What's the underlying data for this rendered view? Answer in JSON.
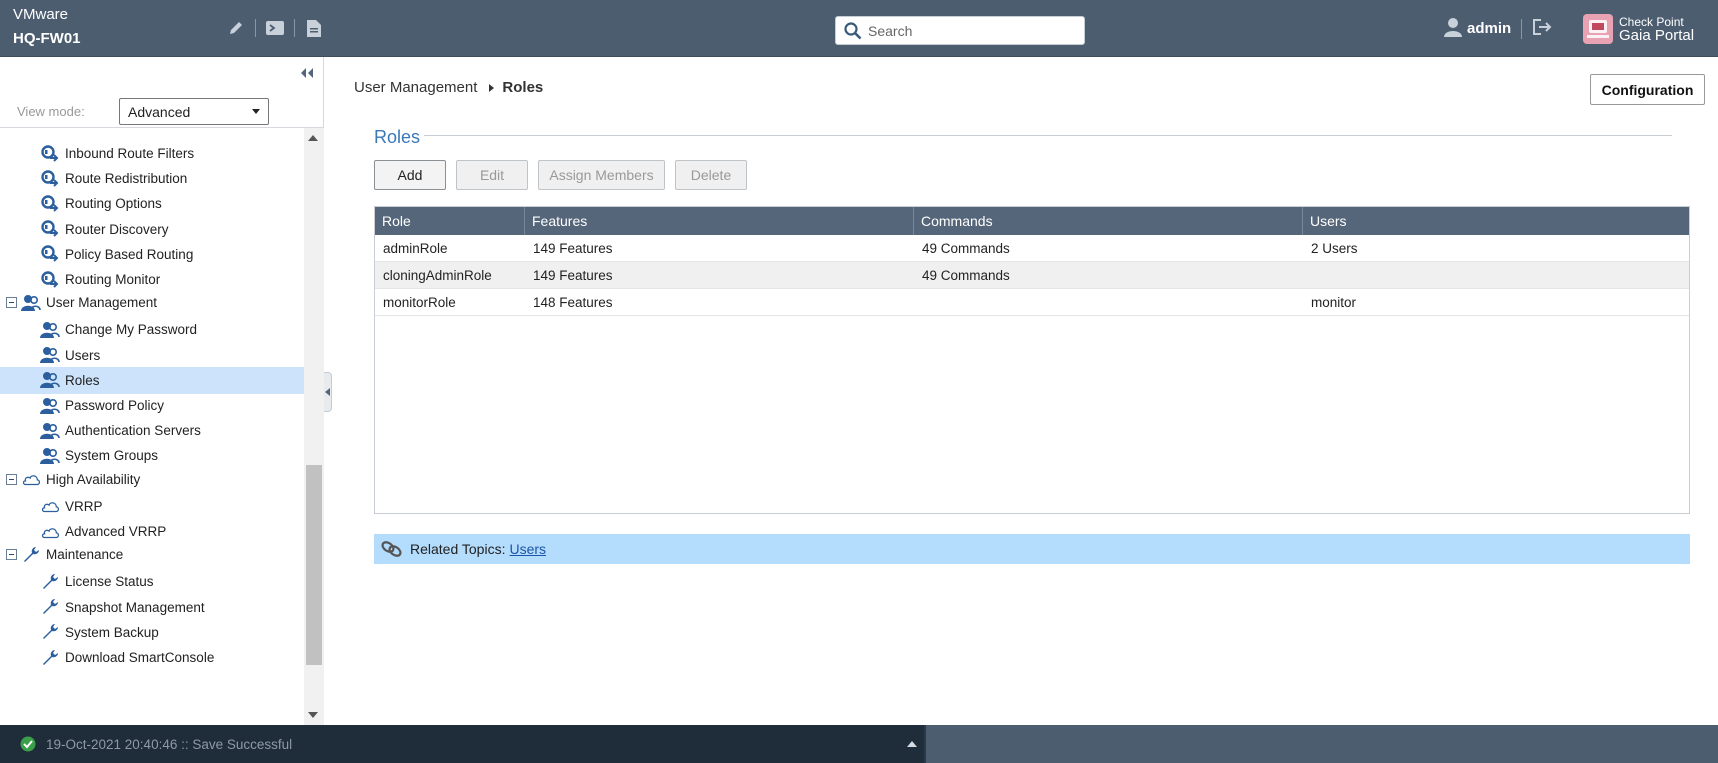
{
  "header": {
    "vendor": "VMware",
    "host": "HQ-FW01",
    "search_placeholder": "Search",
    "user": "admin",
    "logo_line1": "Check Point",
    "logo_line2": "Gaia Portal"
  },
  "sidebar": {
    "view_mode_label": "View mode:",
    "view_mode_value": "Advanced",
    "tree": [
      {
        "label": "Inbound Route Filters",
        "type": "child",
        "icon": "route-icon"
      },
      {
        "label": "Route Redistribution",
        "type": "child",
        "icon": "route-icon"
      },
      {
        "label": "Routing Options",
        "type": "child",
        "icon": "route-icon"
      },
      {
        "label": "Router Discovery",
        "type": "child",
        "icon": "route-icon"
      },
      {
        "label": "Policy Based Routing",
        "type": "child",
        "icon": "route-icon"
      },
      {
        "label": "Routing Monitor",
        "type": "child",
        "icon": "route-icon"
      },
      {
        "label": "User Management",
        "type": "group",
        "icon": "users-icon"
      },
      {
        "label": "Change My Password",
        "type": "child",
        "icon": "users-icon"
      },
      {
        "label": "Users",
        "type": "child",
        "icon": "users-icon"
      },
      {
        "label": "Roles",
        "type": "child",
        "icon": "users-icon",
        "selected": true
      },
      {
        "label": "Password Policy",
        "type": "child",
        "icon": "users-icon"
      },
      {
        "label": "Authentication Servers",
        "type": "child",
        "icon": "users-icon"
      },
      {
        "label": "System Groups",
        "type": "child",
        "icon": "users-icon"
      },
      {
        "label": "High Availability",
        "type": "group",
        "icon": "cloud-icon"
      },
      {
        "label": "VRRP",
        "type": "child",
        "icon": "cloud-icon"
      },
      {
        "label": "Advanced VRRP",
        "type": "child",
        "icon": "cloud-icon"
      },
      {
        "label": "Maintenance",
        "type": "group",
        "icon": "wrench-icon"
      },
      {
        "label": "License Status",
        "type": "child",
        "icon": "wrench-icon"
      },
      {
        "label": "Snapshot Management",
        "type": "child",
        "icon": "wrench-icon"
      },
      {
        "label": "System Backup",
        "type": "child",
        "icon": "wrench-icon"
      },
      {
        "label": "Download SmartConsole",
        "type": "child",
        "icon": "wrench-icon"
      }
    ]
  },
  "main": {
    "breadcrumb_parent": "User Management",
    "breadcrumb_current": "Roles",
    "config_button": "Configuration",
    "section_title": "Roles",
    "buttons": {
      "add": "Add",
      "edit": "Edit",
      "assign": "Assign Members",
      "delete": "Delete"
    },
    "table": {
      "columns": [
        "Role",
        "Features",
        "Commands",
        "Users"
      ],
      "rows": [
        [
          "adminRole",
          "149 Features",
          "49 Commands",
          "2 Users"
        ],
        [
          "cloningAdminRole",
          "149 Features",
          "49 Commands",
          ""
        ],
        [
          "monitorRole",
          "148 Features",
          "",
          "monitor"
        ]
      ]
    },
    "related_label": "Related Topics:",
    "related_link": "Users"
  },
  "status": {
    "message": "19-Oct-2021 20:40:46 :: Save Successful"
  },
  "colors": {
    "topbar": "#4c5d70",
    "accent": "#3a78b8",
    "selected": "#cde3fb",
    "related_bg": "#b3dcfd",
    "ok_green": "#3aa04a"
  }
}
